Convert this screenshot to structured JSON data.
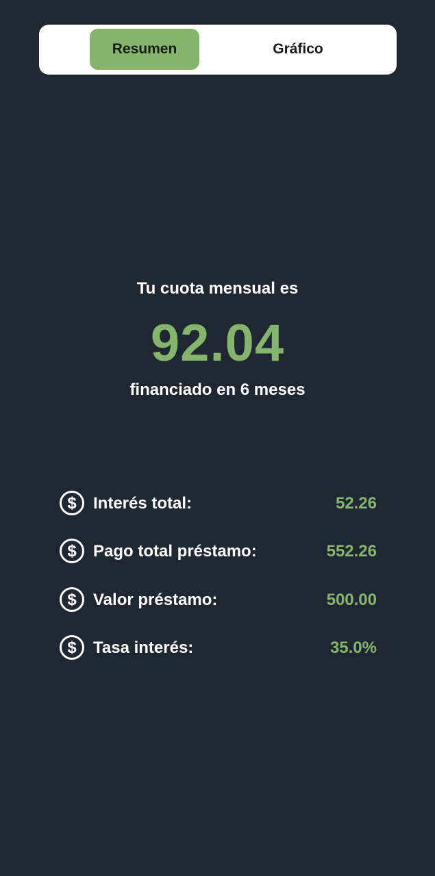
{
  "tabs": [
    {
      "label": "Resumen",
      "active": true
    },
    {
      "label": "Gráfico",
      "active": false
    }
  ],
  "summary": {
    "intro": "Tu cuota mensual es",
    "monthly_payment": "92.04",
    "financed": "financiado en 6 meses"
  },
  "stats": [
    {
      "icon": "dollar-circle-icon",
      "label": "Interés total:",
      "value": "52.26"
    },
    {
      "icon": "dollar-circle-icon",
      "label": "Pago total préstamo:",
      "value": "552.26"
    },
    {
      "icon": "dollar-circle-icon",
      "label": "Valor préstamo:",
      "value": "500.00"
    },
    {
      "icon": "dollar-circle-icon",
      "label": "Tasa interés:",
      "value": "35.0%"
    }
  ],
  "colors": {
    "background": "#1f2832",
    "accent": "#85b56d",
    "text": "#ffffff"
  }
}
